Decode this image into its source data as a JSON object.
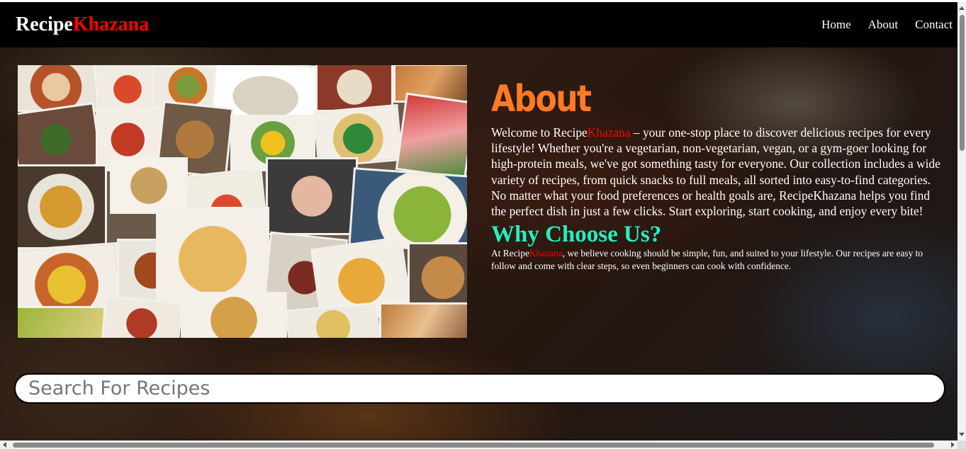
{
  "navbar": {
    "brand_part1": "Recipe",
    "brand_part2": "Khazana",
    "links": [
      "Home",
      "About",
      "Contact"
    ]
  },
  "about": {
    "title": "About",
    "intro_prefix": "Welcome to Recipe",
    "intro_brand": "Khazana",
    "intro_rest": " – your one-stop place to discover delicious recipes for every lifestyle! Whether you're a vegetarian, non-vegetarian, vegan, or a gym-goer looking for high-protein meals, we've got something tasty for everyone. Our collection includes a wide variety of recipes, from quick snacks to full meals, all sorted into easy-to-find categories. No matter what your food preferences or health goals are, RecipeKhazana helps you find the perfect dish in just a few clicks. Start exploring, start cooking, and enjoy every bite!",
    "why_title": "Why Choose Us?",
    "why_prefix": "At Recipe",
    "why_brand": "Khazana",
    "why_rest": ", we believe cooking should be simple, fun, and suited to your lifestyle. Our recipes are easy to follow and come with clear steps, so even beginners can cook with confidence."
  },
  "search": {
    "placeholder": "Search For Recipes",
    "value": ""
  },
  "colors": {
    "navbar_bg": "#000000",
    "brand_accent": "#ff0000",
    "about_title": "#ff7a24",
    "why_title": "#1ff2c0"
  },
  "icons": [
    "food-collage-image"
  ]
}
